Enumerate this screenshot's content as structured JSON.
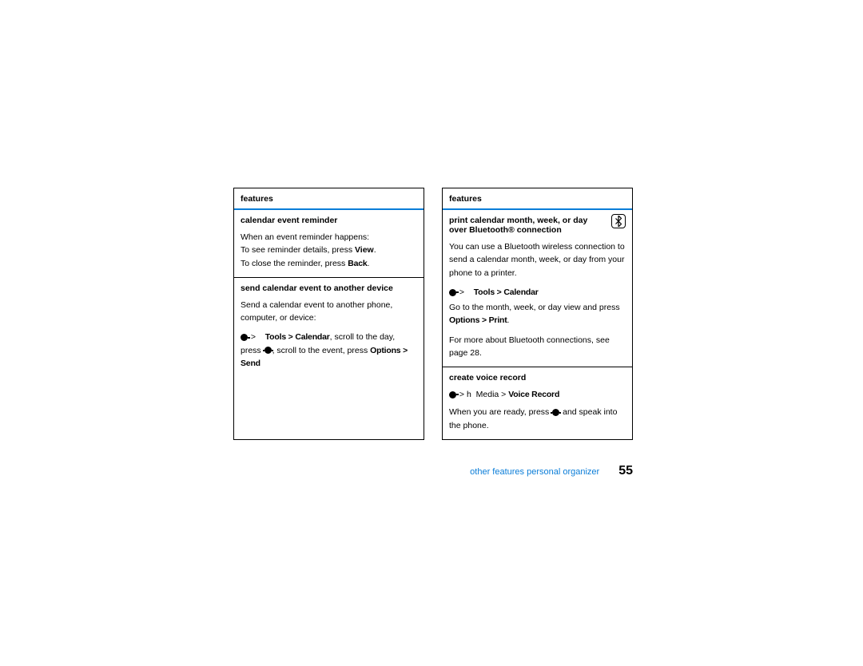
{
  "left": {
    "header": "features",
    "rows": [
      {
        "title": "calendar event reminder",
        "line1": "When an event reminder happens:",
        "line2_pre": "To see reminder details, press ",
        "line2_bold": "View",
        "line2_post": ".",
        "line3_pre": "To close the reminder, press ",
        "line3_bold": "Back",
        "line3_post": "."
      },
      {
        "title": "send calendar event to another device",
        "intro": "Send a calendar event to another phone, computer, or device:",
        "nav_sep": " > ",
        "nav_bold": "Tools > Calendar",
        "nav_post": ", scroll to the day, press ",
        "nav_post2": ", scroll to the event, press ",
        "nav_tail": "Options > Send"
      }
    ]
  },
  "right": {
    "header": "features",
    "rows": [
      {
        "title": "print calendar month, week, or day over Bluetooth® connection",
        "intro": "You can use a Bluetooth wireless connection to send a calendar month, week, or day from your phone to a printer.",
        "nav_sep": " > ",
        "nav_bold": "Tools > Calendar",
        "mid": "Go to the month, week, or day view and press ",
        "mid_bold": "Options > Print",
        "mid_post": ".",
        "outro": "For more about Bluetooth connections, see page 28."
      },
      {
        "title": "create voice record",
        "nav_sep": " > ",
        "nav_h": "h",
        "nav_media": "Media",
        "nav_gt": " > ",
        "nav_vr": "Voice Record",
        "body_pre": "When you are ready, press ",
        "body_post": " and speak into the phone."
      }
    ]
  },
  "footer": {
    "section": "other  features personal organizer",
    "page": "55"
  }
}
